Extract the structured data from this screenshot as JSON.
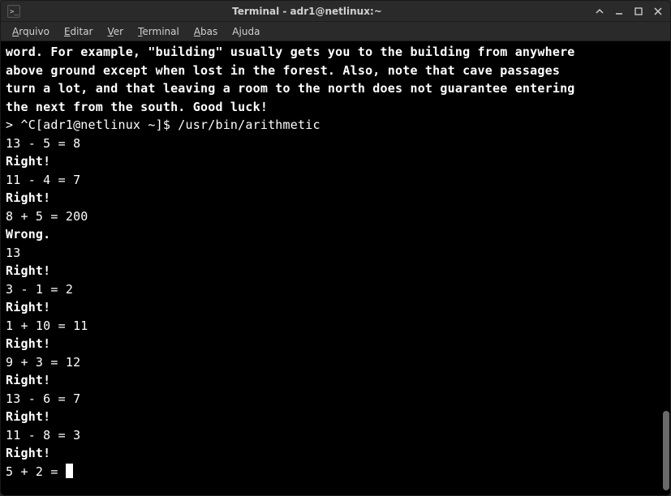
{
  "titlebar": {
    "title": "Terminal - adr1@netlinux:~"
  },
  "menubar": {
    "items": [
      {
        "label": "Arquivo",
        "accel_index": 0
      },
      {
        "label": "Editar",
        "accel_index": 0
      },
      {
        "label": "Ver",
        "accel_index": 0
      },
      {
        "label": "Terminal",
        "accel_index": 0
      },
      {
        "label": "Abas",
        "accel_index": 0
      },
      {
        "label": "Ajuda",
        "accel_index": 1
      }
    ]
  },
  "terminal": {
    "lines": [
      {
        "bold": true,
        "text": "word. For example, \"building\" usually gets you to the building from anywhere"
      },
      {
        "bold": true,
        "text": "above ground except when lost in the forest. Also, note that cave passages"
      },
      {
        "bold": true,
        "text": "turn a lot, and that leaving a room to the north does not guarantee entering"
      },
      {
        "bold": true,
        "text": "the next from the south. Good luck!"
      },
      {
        "bold": false,
        "text": "> ^C[adr1@netlinux ~]$ /usr/bin/arithmetic"
      },
      {
        "bold": false,
        "text": "13 - 5 = 8"
      },
      {
        "bold": true,
        "text": "Right!"
      },
      {
        "bold": false,
        "text": "11 - 4 = 7"
      },
      {
        "bold": true,
        "text": "Right!"
      },
      {
        "bold": false,
        "text": "8 + 5 = 200"
      },
      {
        "bold": true,
        "text": "Wrong."
      },
      {
        "bold": false,
        "text": "13"
      },
      {
        "bold": true,
        "text": "Right!"
      },
      {
        "bold": false,
        "text": "3 - 1 = 2"
      },
      {
        "bold": true,
        "text": "Right!"
      },
      {
        "bold": false,
        "text": "1 + 10 = 11"
      },
      {
        "bold": true,
        "text": "Right!"
      },
      {
        "bold": false,
        "text": "9 + 3 = 12"
      },
      {
        "bold": true,
        "text": "Right!"
      },
      {
        "bold": false,
        "text": "13 - 6 = 7"
      },
      {
        "bold": true,
        "text": "Right!"
      },
      {
        "bold": false,
        "text": "11 - 8 = 3"
      },
      {
        "bold": true,
        "text": "Right!"
      }
    ],
    "prompt_last": "5 + 2 = "
  }
}
